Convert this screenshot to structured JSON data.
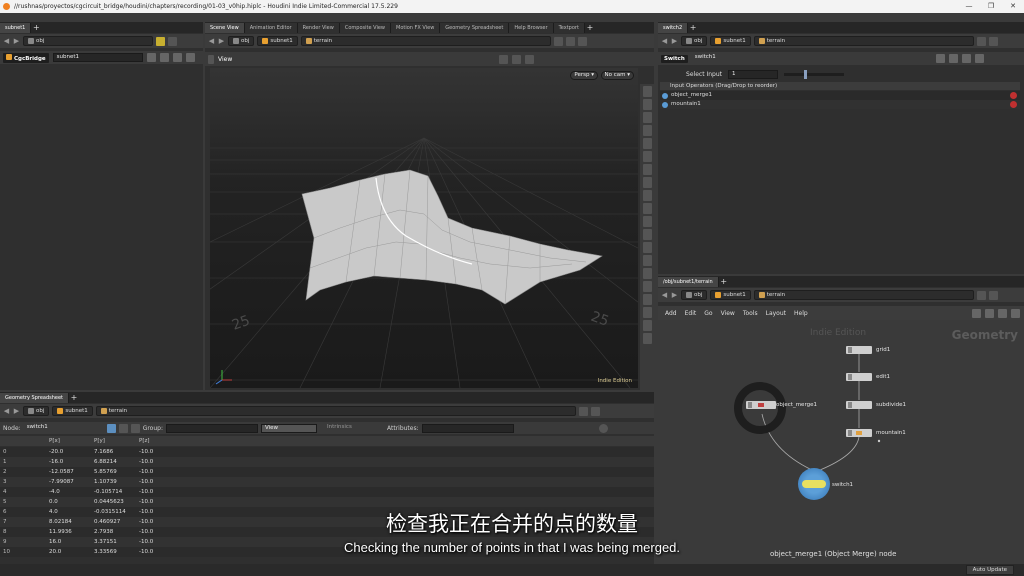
{
  "window": {
    "title": "//rushnas/proyectos/cgcircuit_bridge/houdini/chapters/recording/01-03_v0hip.hiplc - Houdini Indie Limited-Commercial 17.5.229",
    "minimize": "—",
    "maximize": "❐",
    "close": "✕"
  },
  "left_pane": {
    "tab": "subnet1",
    "path": "obj",
    "node_type": "CgcBridge",
    "node_name": "subnet1"
  },
  "scene": {
    "tabs": [
      "Scene View",
      "Animation Editor",
      "Render View",
      "Composite View",
      "Motion FX View",
      "Geometry Spreadsheet",
      "Help Browser",
      "Textport"
    ],
    "crumbs": [
      "obj",
      "subnet1",
      "terrain"
    ],
    "view_label": "View",
    "persp": "Persp ▾",
    "cam": "No cam ▾",
    "watermark": "Indie Edition",
    "grid_labels": [
      "25",
      "25"
    ]
  },
  "params": {
    "tab": "switch2",
    "crumbs": [
      "obj",
      "subnet1",
      "terrain"
    ],
    "node_type": "Switch",
    "node_name": "switch1",
    "select_label": "Select Input",
    "select_value": "1",
    "inputs_header": "Input Operators (Drag/Drop to reorder)",
    "inputs": [
      "object_merge1",
      "mountain1"
    ]
  },
  "spreadsheet": {
    "tab": "Geometry Spreadsheet",
    "crumbs": [
      "obj",
      "subnet1",
      "terrain"
    ],
    "node_label": "Node:",
    "node_value": "switch1",
    "group_label": "Group:",
    "view_label": "View",
    "intrinsics_label": "Intrinsics",
    "attributes_label": "Attributes:",
    "columns": [
      "",
      "P[x]",
      "P[y]",
      "P[z]"
    ],
    "rows": [
      [
        "0",
        "-20.0",
        "7.1686",
        "-10.0"
      ],
      [
        "1",
        "-16.0",
        "6.88214",
        "-10.0"
      ],
      [
        "2",
        "-12.0587",
        "5.85769",
        "-10.0"
      ],
      [
        "3",
        "-7.99087",
        "1.10739",
        "-10.0"
      ],
      [
        "4",
        "-4.0",
        "-0.105714",
        "-10.0"
      ],
      [
        "5",
        "0.0",
        "0.0445623",
        "-10.0"
      ],
      [
        "6",
        "4.0",
        "-0.0315114",
        "-10.0"
      ],
      [
        "7",
        "8.02184",
        "0.460927",
        "-10.0"
      ],
      [
        "8",
        "11.9936",
        "2.7938",
        "-10.0"
      ],
      [
        "9",
        "16.0",
        "3.37151",
        "-10.0"
      ],
      [
        "10",
        "20.0",
        "3.33569",
        "-10.0"
      ]
    ]
  },
  "network": {
    "tab": "/obj/subnet1/terrain",
    "crumbs": [
      "obj",
      "subnet1",
      "terrain"
    ],
    "menu": [
      "Add",
      "Edit",
      "Go",
      "View",
      "Tools",
      "Layout",
      "Help"
    ],
    "watermark": "Indie Edition",
    "context": "Geometry",
    "nodes": [
      "grid1",
      "edit1",
      "subdivide1",
      "mountain1",
      "object_merge1",
      "switch1"
    ],
    "status": "object_merge1 (Object Merge) node"
  },
  "subtitles": {
    "cn": "检查我正在合并的点的数量",
    "en": "Checking the number of points in that I was being merged."
  },
  "status": {
    "auto_update": "Auto Update"
  }
}
